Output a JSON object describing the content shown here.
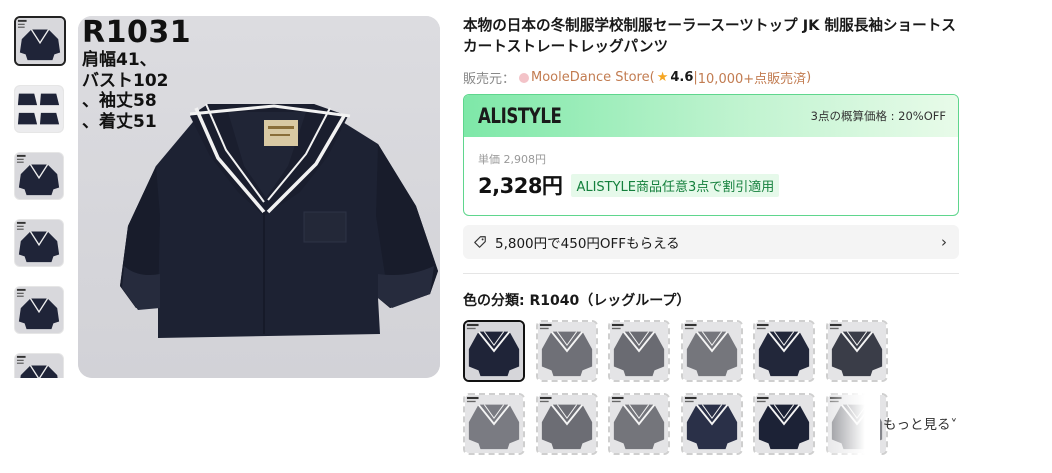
{
  "product": {
    "title": "本物の日本の冬制服学校制服セーラースーツトップ JK 制服長袖ショートスカートストレートレッグパンツ",
    "seller_prefix": "販売元：",
    "store_name": "MooleDance Store",
    "store_open": " (",
    "rating": "4.6",
    "sold_separator": " | ",
    "sold": "10,000+点販売済",
    "store_close": " )"
  },
  "main_image": {
    "code": "R1031",
    "lines": [
      "肩幅41、",
      "バスト102",
      "、袖丈58",
      "、着丈51"
    ]
  },
  "thumbnails": [
    {
      "icon": "sailor-top-navy",
      "active": true
    },
    {
      "icon": "sailor-top-grid",
      "active": false
    },
    {
      "icon": "sailor-top-navy",
      "active": false
    },
    {
      "icon": "sailor-top-navy",
      "active": false
    },
    {
      "icon": "sailor-top-navy",
      "active": false
    },
    {
      "icon": "sailor-top-navy",
      "active": false
    }
  ],
  "promo": {
    "brand": "ALISTYLE",
    "approx_price": "3点の概算価格 : 20%OFF",
    "unit_price": "単価 2,908円",
    "price": "2,328円",
    "tag": "ALISTYLE商品任意3点で割引適用"
  },
  "coupon": {
    "text": "5,800円で450円OFFもらえる",
    "icon": "tag-icon",
    "chevron": "›"
  },
  "color": {
    "label": "色の分類: ",
    "selected": "R1040（レッグループ）"
  },
  "swatches": [
    {
      "tone": "#1f2438",
      "active": true
    },
    {
      "tone": "#6f7077",
      "active": false
    },
    {
      "tone": "#6a6b72",
      "active": false
    },
    {
      "tone": "#75767c",
      "active": false
    },
    {
      "tone": "#22273a",
      "active": false
    },
    {
      "tone": "#3a3d48",
      "active": false
    },
    {
      "tone": "#7a7b82",
      "active": false
    },
    {
      "tone": "#6c6d74",
      "active": false
    },
    {
      "tone": "#74757b",
      "active": false
    },
    {
      "tone": "#2a3048",
      "active": false
    },
    {
      "tone": "#1c2236",
      "active": false
    },
    {
      "tone": "#85868c",
      "active": false
    }
  ],
  "more_label": "もっと見る",
  "more_chevron": "˅",
  "colors": {
    "accent_green": "#5fd68d",
    "tag_green": "#15803d",
    "store_brown": "#c27c51",
    "star": "#f5a623"
  }
}
